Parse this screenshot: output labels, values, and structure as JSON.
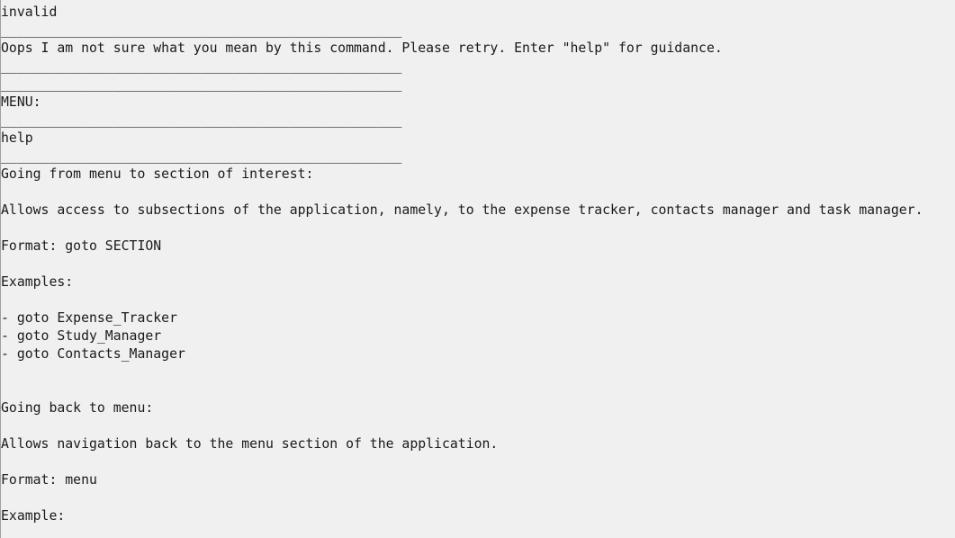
{
  "console": {
    "lines": [
      "invalid",
      "__________________________________________________",
      "Oops I am not sure what you mean by this command. Please retry. Enter \"help\" for guidance.",
      "__________________________________________________",
      "__________________________________________________",
      "MENU:",
      "__________________________________________________",
      "help",
      "__________________________________________________",
      "Going from menu to section of interest:",
      "",
      "Allows access to subsections of the application, namely, to the expense tracker, contacts manager and task manager.",
      "",
      "Format: goto SECTION",
      "",
      "Examples:",
      "",
      "- goto Expense_Tracker",
      "- goto Study_Manager",
      "- goto Contacts_Manager",
      "",
      "",
      "Going back to menu:",
      "",
      "Allows navigation back to the menu section of the application.",
      "",
      "Format: menu",
      "",
      "Example:"
    ]
  }
}
